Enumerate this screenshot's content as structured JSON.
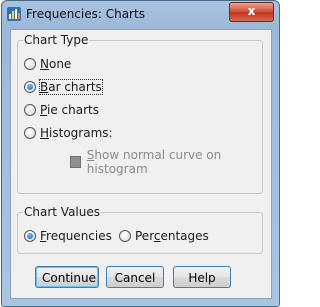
{
  "window": {
    "title": "Frequencies: Charts",
    "close_label": "x"
  },
  "chart_type": {
    "legend": "Chart Type",
    "options": [
      {
        "pre": "",
        "key": "N",
        "post": "one",
        "selected": false
      },
      {
        "pre": "",
        "key": "B",
        "post": "ar charts",
        "selected": true
      },
      {
        "pre": "",
        "key": "P",
        "post": "ie charts",
        "selected": false
      },
      {
        "pre": "",
        "key": "H",
        "post": "istograms:",
        "selected": false
      }
    ],
    "normal_curve": {
      "pre": "",
      "key": "S",
      "post": "how normal curve on histogram",
      "checked": false,
      "enabled": false
    }
  },
  "chart_values": {
    "legend": "Chart Values",
    "options": [
      {
        "pre": "",
        "key": "F",
        "post": "requencies",
        "selected": true
      },
      {
        "pre": "Per",
        "key": "c",
        "post": "entages",
        "selected": false
      }
    ]
  },
  "buttons": {
    "continue": "Continue",
    "cancel": "Cancel",
    "help": "Help"
  }
}
